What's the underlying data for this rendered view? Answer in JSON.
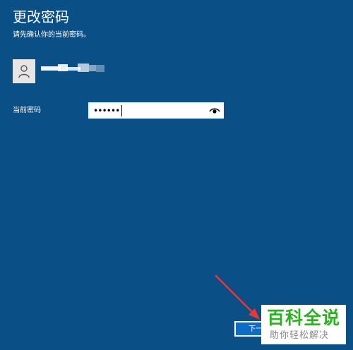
{
  "header": {
    "title": "更改密码",
    "subtitle": "请先确认你的当前密码。"
  },
  "account": {
    "avatar_icon": "user-avatar-icon"
  },
  "form": {
    "password_label": "当前密码",
    "password_value": "••••••",
    "reveal_icon": "eye-icon"
  },
  "actions": {
    "next_label": "下一步"
  },
  "watermark": {
    "main": "百科全说",
    "sub": "助你轻松解决"
  },
  "colors": {
    "background": "#0a4f86",
    "button": "#0f6cc6",
    "watermark_green": "#2bb21e",
    "annotation_arrow": "#e53935"
  }
}
